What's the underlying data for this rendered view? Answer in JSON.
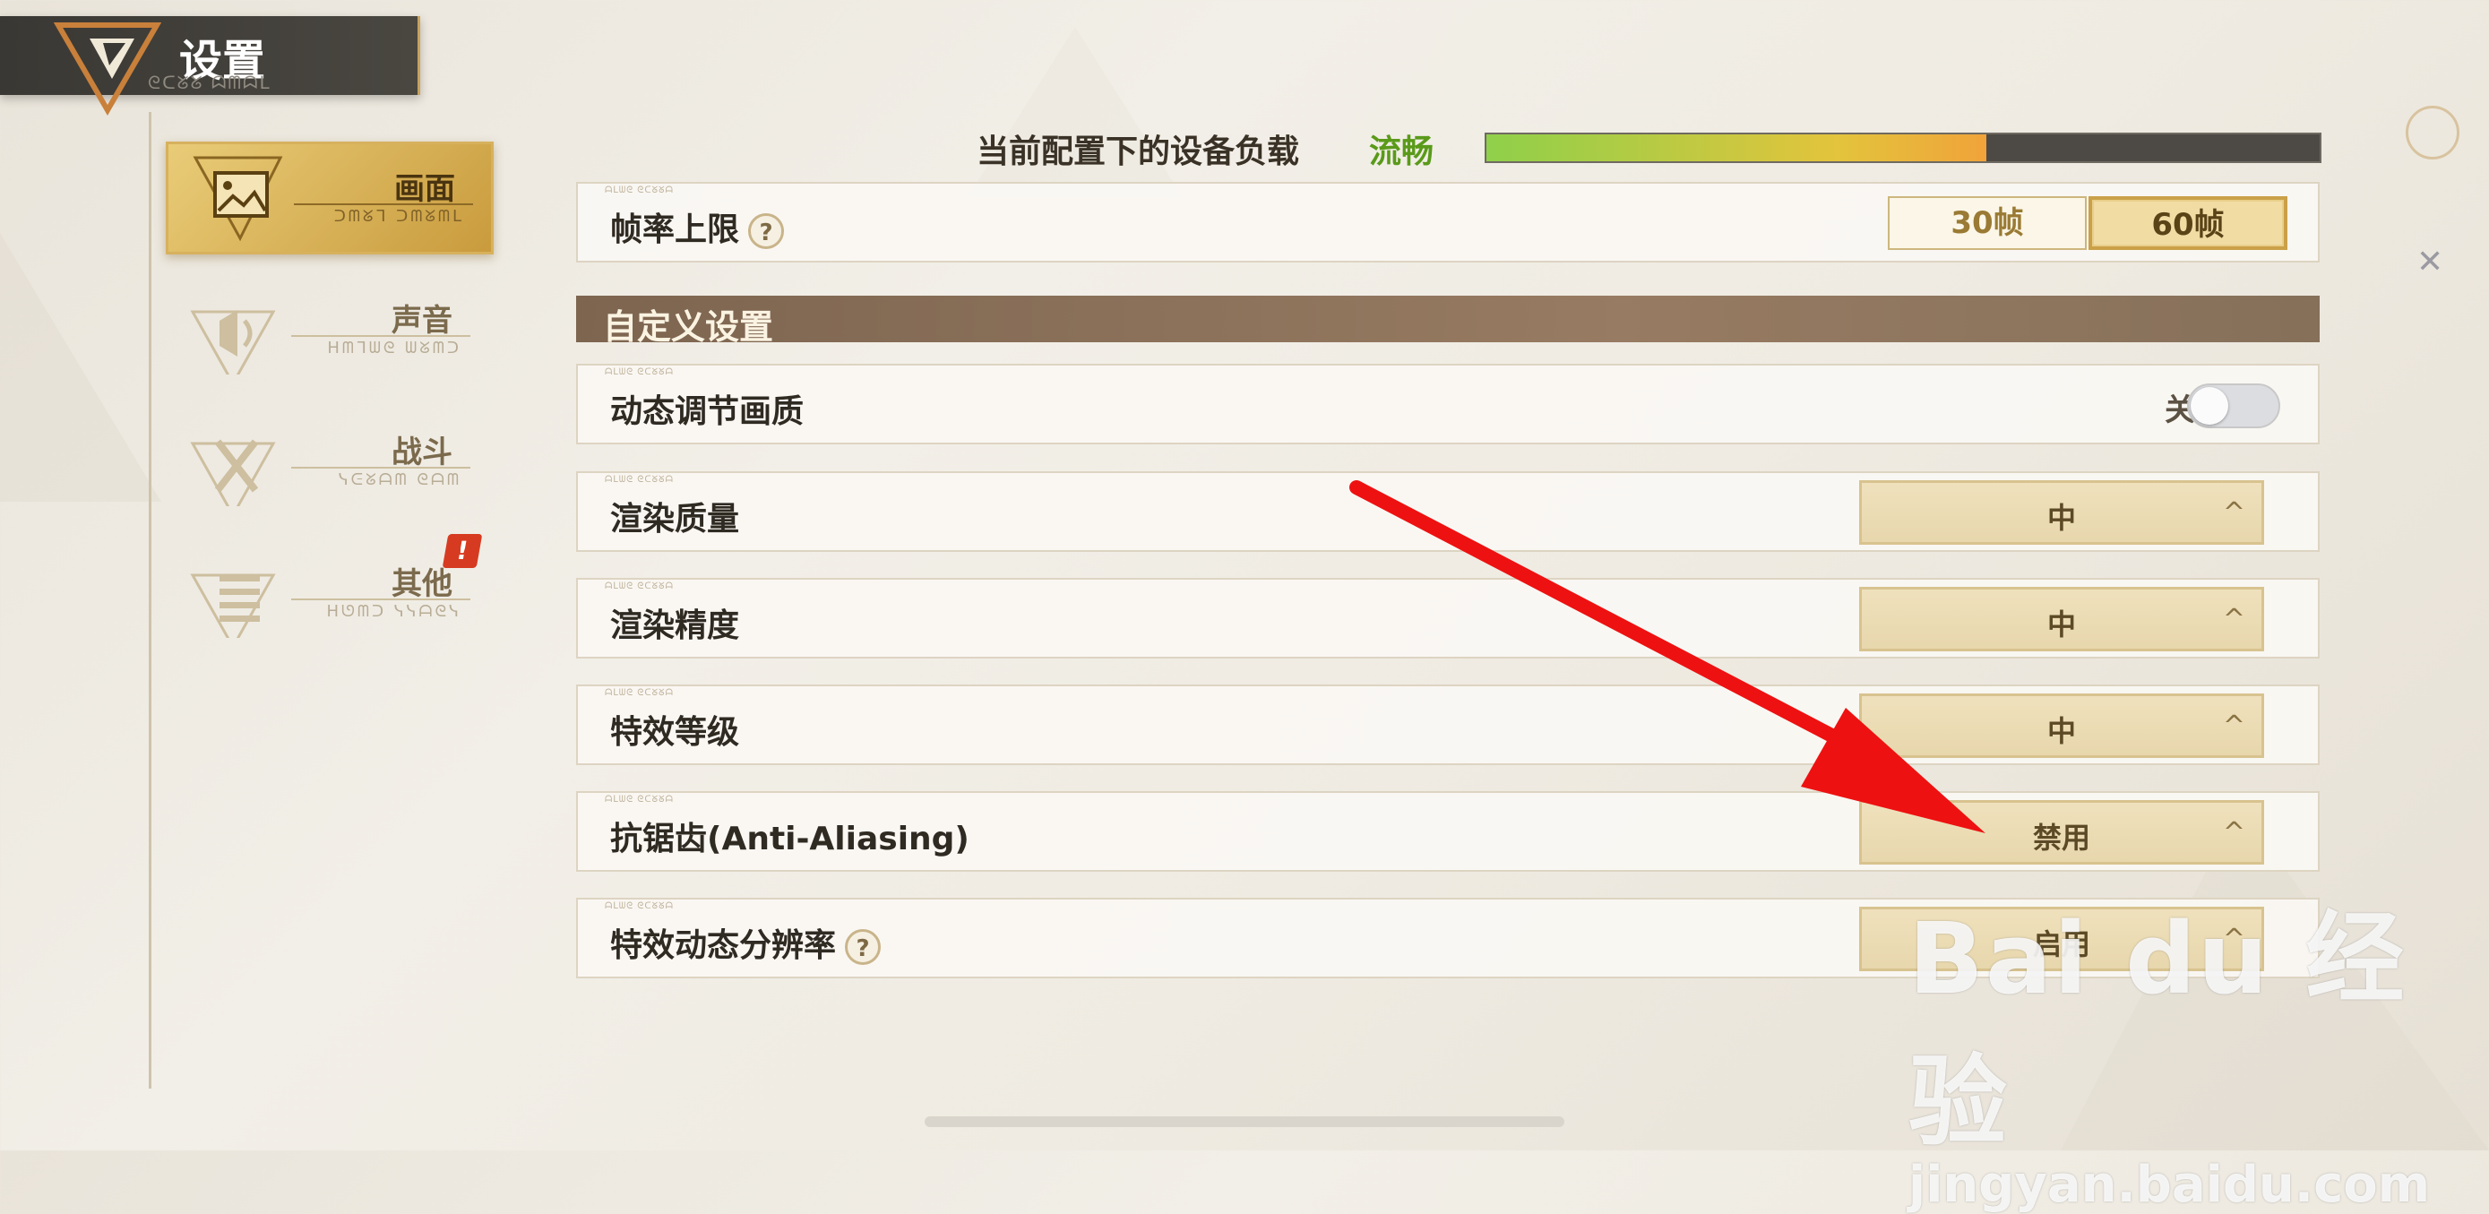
{
  "header": {
    "title": "设置",
    "subtitle": "ᘓᑕᘜᘜ ᗣᗰᗣᒪ"
  },
  "sidebar": {
    "items": [
      {
        "label": "画面",
        "sub": "ᑐᗰᘜᒣ ᑐᗰᘜᗰᒪ",
        "active": true
      },
      {
        "label": "声音",
        "sub": "ᕼᗰᒣᗯᘓ ᗯᘜᗰᑐ",
        "active": false
      },
      {
        "label": "战斗",
        "sub": "ᓭᕮᘜᗩᗰ ᘓᗩᗰ",
        "active": false
      },
      {
        "label": "其他",
        "sub": "ᕼᘎᗰᑐ ᓭᓭᗩᘓᓭ",
        "active": false
      }
    ],
    "badge": "!"
  },
  "load": {
    "label": "当前配置下的设备负载",
    "status": "流畅",
    "level_percent": 60
  },
  "settings": {
    "frame_limit": {
      "label": "帧率上限",
      "help": "?",
      "options": [
        "30帧",
        "60帧"
      ],
      "selected": "60帧"
    },
    "section_title": "自定义设置",
    "dynamic_quality": {
      "label": "动态调节画质",
      "state_label": "关",
      "on": false
    },
    "render_quality": {
      "label": "渲染质量",
      "value": "中",
      "chevron": "^"
    },
    "render_precision": {
      "label": "渲染精度",
      "value": "中",
      "chevron": "^"
    },
    "effects_level": {
      "label": "特效等级",
      "value": "中",
      "chevron": "^"
    },
    "anti_aliasing": {
      "label": "抗锯齿(Anti-Aliasing)",
      "value": "禁用",
      "chevron": "^"
    },
    "effects_dynamic_res": {
      "label": "特效动态分辨率",
      "help": "?",
      "value": "启用",
      "chevron": "^"
    },
    "row_tag": "ᗩᒪᗯᘓ ᘓᑕᘜᘜᗩ"
  },
  "watermark": {
    "line1": "Bai du 经验",
    "line2": "jingyan.baidu.com"
  },
  "colors": {
    "accent_gold": "#c99b3d",
    "status_green": "#5a9a1a",
    "arrow_red": "#ee1111"
  }
}
